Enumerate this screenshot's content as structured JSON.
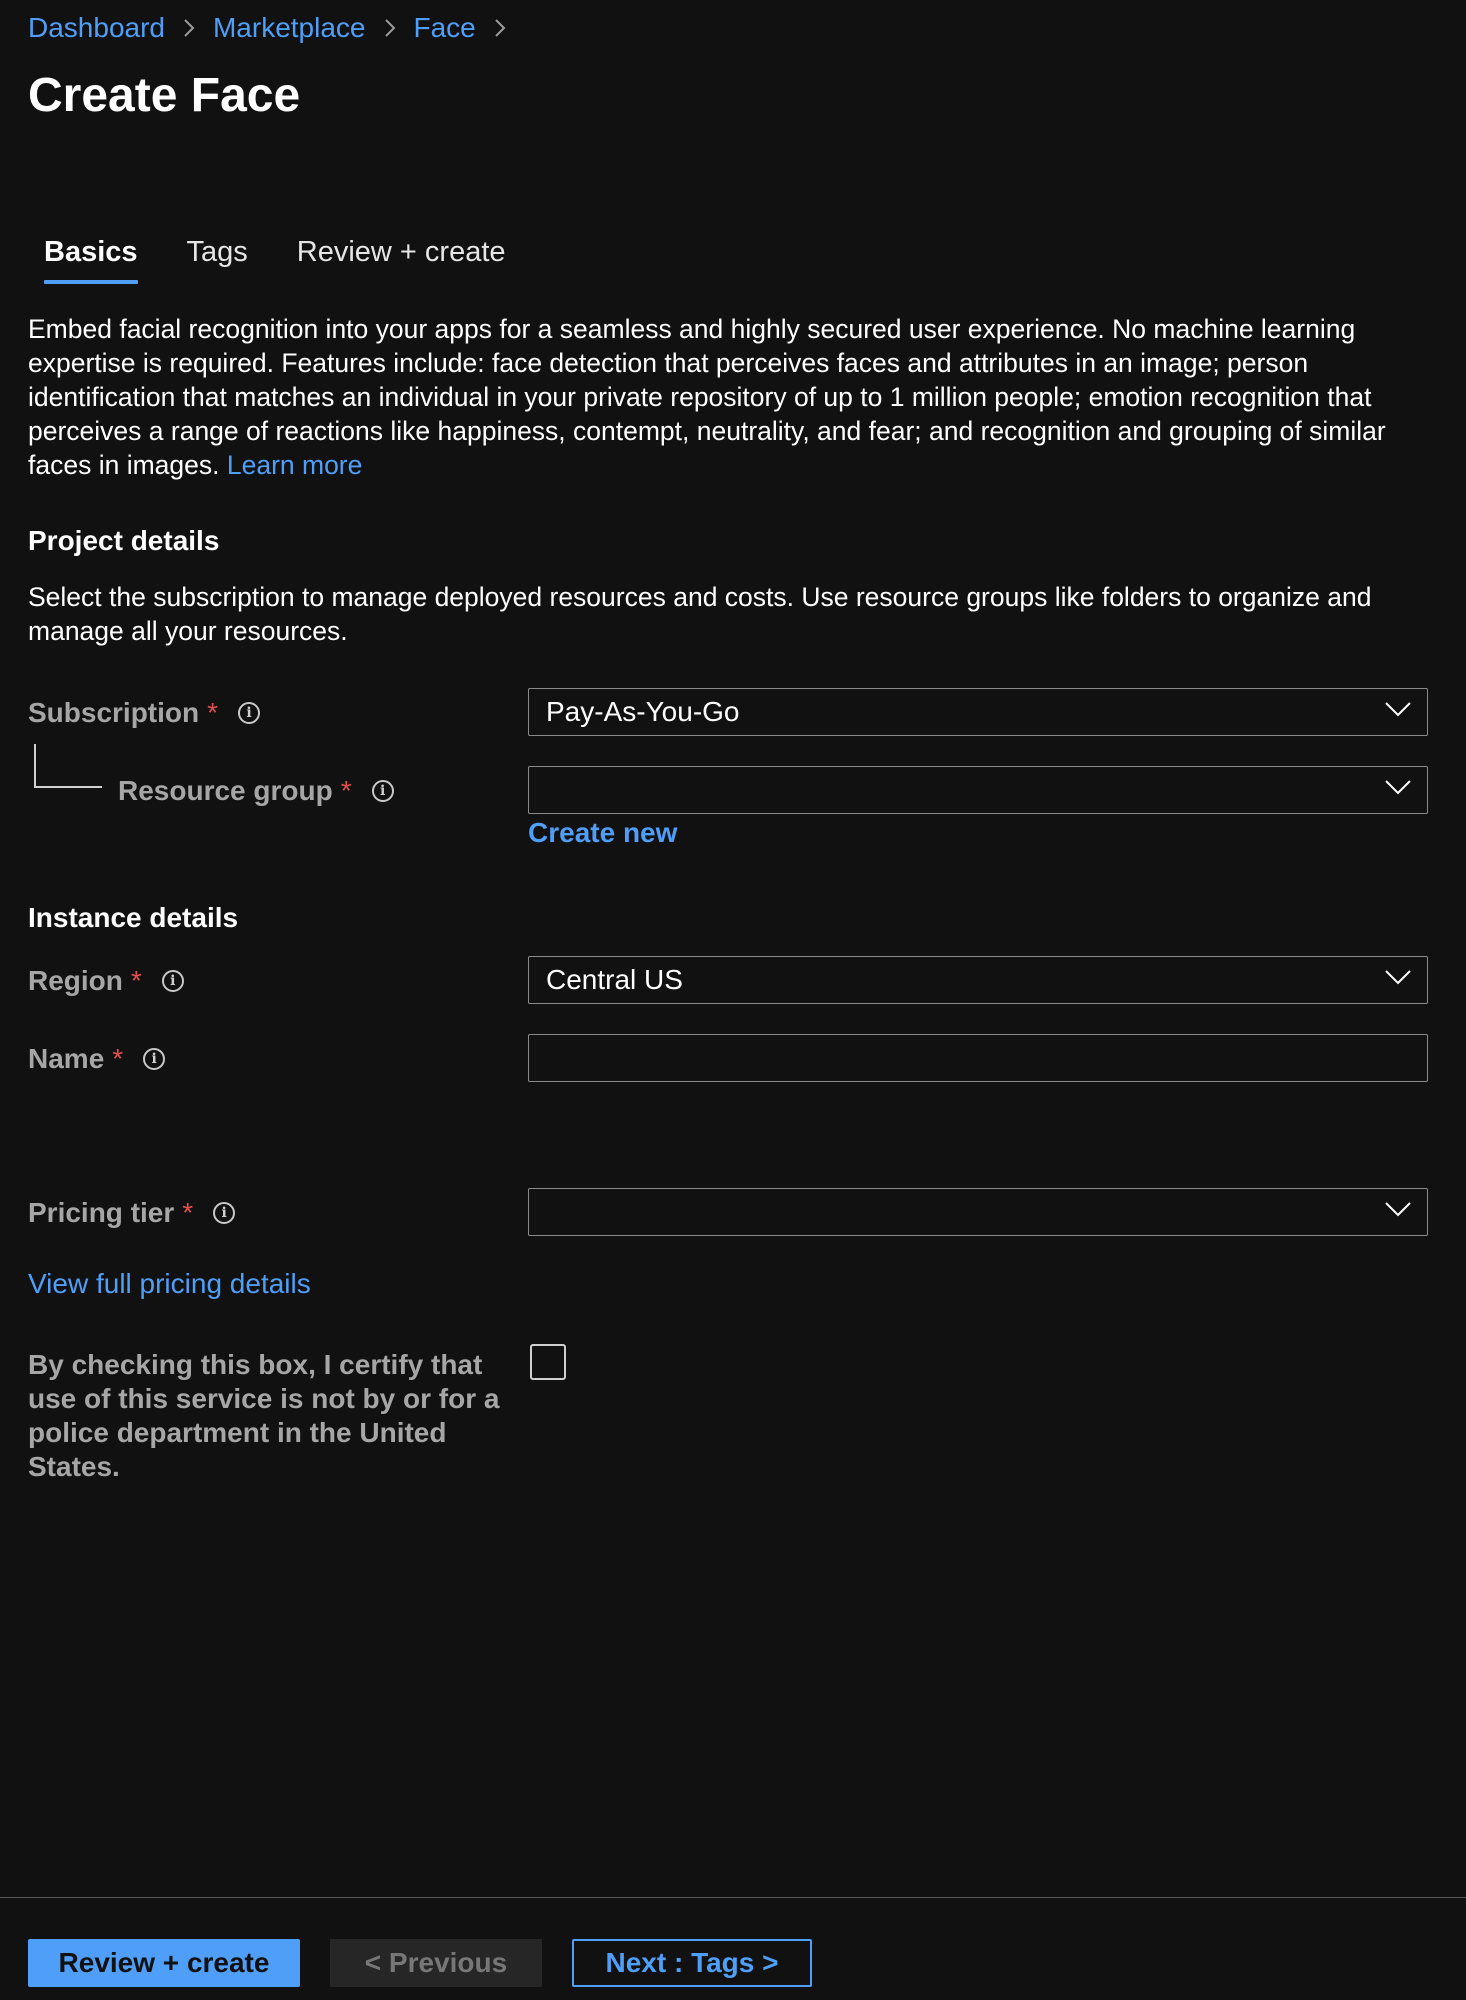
{
  "breadcrumb": {
    "items": [
      {
        "label": "Dashboard"
      },
      {
        "label": "Marketplace"
      },
      {
        "label": "Face"
      }
    ]
  },
  "page": {
    "title": "Create Face"
  },
  "tabs": [
    {
      "label": "Basics",
      "active": true
    },
    {
      "label": "Tags",
      "active": false
    },
    {
      "label": "Review + create",
      "active": false
    }
  ],
  "description": {
    "text": "Embed facial recognition into your apps for a seamless and highly secured user experience. No machine learning expertise is required. Features include: face detection that perceives faces and attributes in an image; person identification that matches an individual in your private repository of up to 1 million people; emotion recognition that perceives a range of reactions like happiness, contempt, neutrality, and fear; and recognition and grouping of similar faces in images.",
    "learn_more": "Learn more"
  },
  "project_details": {
    "heading": "Project details",
    "description": "Select the subscription to manage deployed resources and costs. Use resource groups like folders to organize and manage all your resources.",
    "subscription": {
      "label": "Subscription",
      "required_mark": "*",
      "value": "Pay-As-You-Go"
    },
    "resource_group": {
      "label": "Resource group",
      "required_mark": "*",
      "value": "",
      "create_new": "Create new"
    }
  },
  "instance_details": {
    "heading": "Instance details",
    "region": {
      "label": "Region",
      "required_mark": "*",
      "value": "Central US"
    },
    "name": {
      "label": "Name",
      "required_mark": "*",
      "value": ""
    },
    "pricing_tier": {
      "label": "Pricing tier",
      "required_mark": "*",
      "value": ""
    },
    "pricing_link": "View full pricing details",
    "certify": {
      "text": "By checking this box, I certify that use of this service is not by or for a police department in the United States.",
      "checked": false
    }
  },
  "footer": {
    "review_create": "Review + create",
    "previous": "< Previous",
    "next": "Next : Tags >"
  },
  "icons": {
    "info": "i",
    "breadcrumb_separator": "chevron-right-icon",
    "dropdown": "chevron-down-icon"
  },
  "colors": {
    "background": "#111112",
    "accent": "#4f9ef7",
    "required": "#e24e4e",
    "label": "#a6a6a6"
  }
}
